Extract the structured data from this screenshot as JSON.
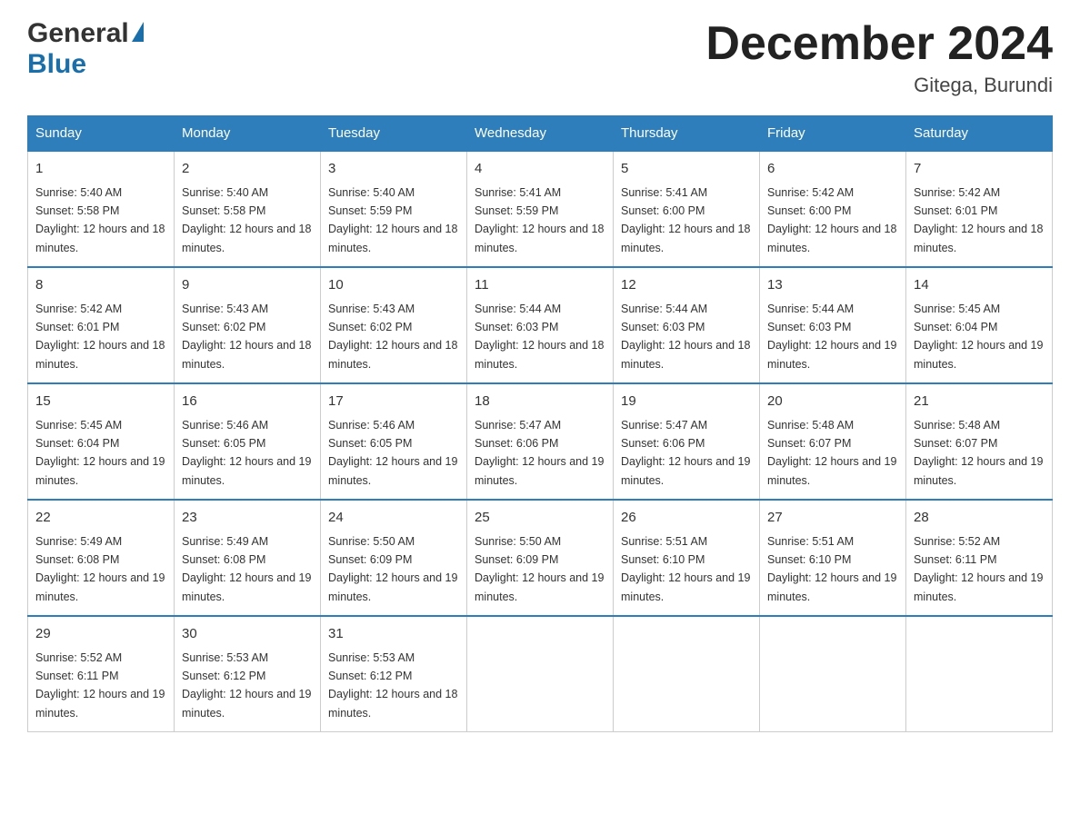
{
  "header": {
    "logo_general": "General",
    "logo_blue": "Blue",
    "month_title": "December 2024",
    "location": "Gitega, Burundi"
  },
  "weekdays": [
    "Sunday",
    "Monday",
    "Tuesday",
    "Wednesday",
    "Thursday",
    "Friday",
    "Saturday"
  ],
  "weeks": [
    [
      {
        "day": "1",
        "sunrise": "5:40 AM",
        "sunset": "5:58 PM",
        "daylight": "12 hours and 18 minutes."
      },
      {
        "day": "2",
        "sunrise": "5:40 AM",
        "sunset": "5:58 PM",
        "daylight": "12 hours and 18 minutes."
      },
      {
        "day": "3",
        "sunrise": "5:40 AM",
        "sunset": "5:59 PM",
        "daylight": "12 hours and 18 minutes."
      },
      {
        "day": "4",
        "sunrise": "5:41 AM",
        "sunset": "5:59 PM",
        "daylight": "12 hours and 18 minutes."
      },
      {
        "day": "5",
        "sunrise": "5:41 AM",
        "sunset": "6:00 PM",
        "daylight": "12 hours and 18 minutes."
      },
      {
        "day": "6",
        "sunrise": "5:42 AM",
        "sunset": "6:00 PM",
        "daylight": "12 hours and 18 minutes."
      },
      {
        "day": "7",
        "sunrise": "5:42 AM",
        "sunset": "6:01 PM",
        "daylight": "12 hours and 18 minutes."
      }
    ],
    [
      {
        "day": "8",
        "sunrise": "5:42 AM",
        "sunset": "6:01 PM",
        "daylight": "12 hours and 18 minutes."
      },
      {
        "day": "9",
        "sunrise": "5:43 AM",
        "sunset": "6:02 PM",
        "daylight": "12 hours and 18 minutes."
      },
      {
        "day": "10",
        "sunrise": "5:43 AM",
        "sunset": "6:02 PM",
        "daylight": "12 hours and 18 minutes."
      },
      {
        "day": "11",
        "sunrise": "5:44 AM",
        "sunset": "6:03 PM",
        "daylight": "12 hours and 18 minutes."
      },
      {
        "day": "12",
        "sunrise": "5:44 AM",
        "sunset": "6:03 PM",
        "daylight": "12 hours and 18 minutes."
      },
      {
        "day": "13",
        "sunrise": "5:44 AM",
        "sunset": "6:03 PM",
        "daylight": "12 hours and 19 minutes."
      },
      {
        "day": "14",
        "sunrise": "5:45 AM",
        "sunset": "6:04 PM",
        "daylight": "12 hours and 19 minutes."
      }
    ],
    [
      {
        "day": "15",
        "sunrise": "5:45 AM",
        "sunset": "6:04 PM",
        "daylight": "12 hours and 19 minutes."
      },
      {
        "day": "16",
        "sunrise": "5:46 AM",
        "sunset": "6:05 PM",
        "daylight": "12 hours and 19 minutes."
      },
      {
        "day": "17",
        "sunrise": "5:46 AM",
        "sunset": "6:05 PM",
        "daylight": "12 hours and 19 minutes."
      },
      {
        "day": "18",
        "sunrise": "5:47 AM",
        "sunset": "6:06 PM",
        "daylight": "12 hours and 19 minutes."
      },
      {
        "day": "19",
        "sunrise": "5:47 AM",
        "sunset": "6:06 PM",
        "daylight": "12 hours and 19 minutes."
      },
      {
        "day": "20",
        "sunrise": "5:48 AM",
        "sunset": "6:07 PM",
        "daylight": "12 hours and 19 minutes."
      },
      {
        "day": "21",
        "sunrise": "5:48 AM",
        "sunset": "6:07 PM",
        "daylight": "12 hours and 19 minutes."
      }
    ],
    [
      {
        "day": "22",
        "sunrise": "5:49 AM",
        "sunset": "6:08 PM",
        "daylight": "12 hours and 19 minutes."
      },
      {
        "day": "23",
        "sunrise": "5:49 AM",
        "sunset": "6:08 PM",
        "daylight": "12 hours and 19 minutes."
      },
      {
        "day": "24",
        "sunrise": "5:50 AM",
        "sunset": "6:09 PM",
        "daylight": "12 hours and 19 minutes."
      },
      {
        "day": "25",
        "sunrise": "5:50 AM",
        "sunset": "6:09 PM",
        "daylight": "12 hours and 19 minutes."
      },
      {
        "day": "26",
        "sunrise": "5:51 AM",
        "sunset": "6:10 PM",
        "daylight": "12 hours and 19 minutes."
      },
      {
        "day": "27",
        "sunrise": "5:51 AM",
        "sunset": "6:10 PM",
        "daylight": "12 hours and 19 minutes."
      },
      {
        "day": "28",
        "sunrise": "5:52 AM",
        "sunset": "6:11 PM",
        "daylight": "12 hours and 19 minutes."
      }
    ],
    [
      {
        "day": "29",
        "sunrise": "5:52 AM",
        "sunset": "6:11 PM",
        "daylight": "12 hours and 19 minutes."
      },
      {
        "day": "30",
        "sunrise": "5:53 AM",
        "sunset": "6:12 PM",
        "daylight": "12 hours and 19 minutes."
      },
      {
        "day": "31",
        "sunrise": "5:53 AM",
        "sunset": "6:12 PM",
        "daylight": "12 hours and 18 minutes."
      },
      null,
      null,
      null,
      null
    ]
  ]
}
